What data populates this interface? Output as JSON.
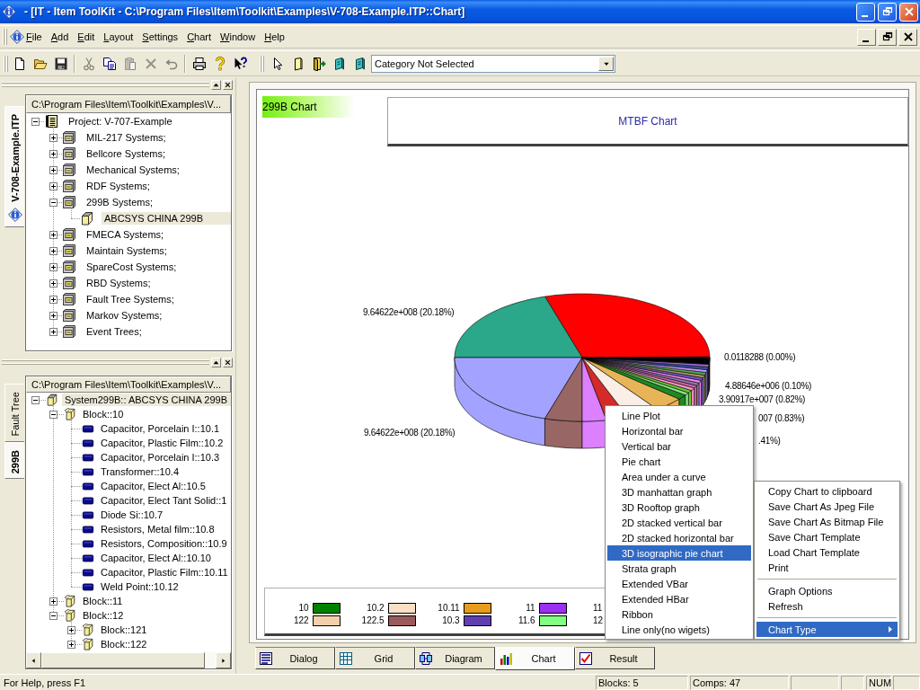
{
  "window": {
    "title": "- [IT - Item ToolKit - C:\\Program Files\\Item\\Toolkit\\Examples\\V-708-Example.ITP::Chart]"
  },
  "menu_bar": [
    "File",
    "Add",
    "Edit",
    "Layout",
    "Settings",
    "Chart",
    "Window",
    "Help"
  ],
  "toolbar": {
    "groups": [
      [
        {
          "kind": "new",
          "disabled": false
        },
        {
          "kind": "open",
          "disabled": false
        },
        {
          "kind": "save",
          "disabled": false
        }
      ],
      [
        {
          "kind": "cut",
          "disabled": true
        },
        {
          "kind": "copy",
          "disabled": false
        },
        {
          "kind": "paste",
          "disabled": true
        },
        {
          "kind": "delete",
          "disabled": true
        },
        {
          "kind": "undo",
          "disabled": true
        }
      ],
      [
        {
          "kind": "print",
          "disabled": false
        },
        {
          "kind": "help",
          "disabled": false
        },
        {
          "kind": "context_help",
          "disabled": false
        }
      ]
    ],
    "tools": [
      {
        "kind": "pointer",
        "disabled": false
      },
      {
        "kind": "document",
        "disabled": false
      },
      {
        "kind": "exit",
        "disabled": false
      },
      {
        "kind": "booklet",
        "disabled": false
      },
      {
        "kind": "booklet",
        "disabled": false
      }
    ],
    "category": "Category Not Selected"
  },
  "project_panel": {
    "tab": {
      "label": "V-708-Example.ITP",
      "selected": true
    },
    "path": "C:\\Program Files\\Item\\Toolkit\\Examples\\V...",
    "tree": [
      {
        "label": "Project: V-707-Example",
        "kind": "project",
        "expanded": true,
        "selected": false,
        "children": [
          {
            "label": "MIL-217 Systems;",
            "kind": "system",
            "expanded": false,
            "selected": false
          },
          {
            "label": "Bellcore Systems;",
            "kind": "system",
            "expanded": false,
            "selected": false
          },
          {
            "label": "Mechanical Systems;",
            "kind": "system",
            "expanded": false,
            "selected": false
          },
          {
            "label": "RDF Systems;",
            "kind": "system",
            "expanded": false,
            "selected": false
          },
          {
            "label": "299B Systems;",
            "kind": "system",
            "expanded": true,
            "selected": false,
            "children": [
              {
                "label": "ABCSYS CHINA 299B",
                "kind": "assembly",
                "selected": true
              }
            ]
          },
          {
            "label": "FMECA Systems;",
            "kind": "system",
            "expanded": false,
            "selected": false
          },
          {
            "label": "Maintain Systems;",
            "kind": "system",
            "expanded": false,
            "selected": false
          },
          {
            "label": "SpareCost Systems;",
            "kind": "system",
            "expanded": false,
            "selected": false
          },
          {
            "label": "RBD Systems;",
            "kind": "system",
            "expanded": false,
            "selected": false
          },
          {
            "label": "Fault Tree Systems;",
            "kind": "system",
            "expanded": false,
            "selected": false
          },
          {
            "label": "Markov Systems;",
            "kind": "system",
            "expanded": false,
            "selected": false
          },
          {
            "label": "Event Trees;",
            "kind": "system",
            "expanded": false,
            "selected": false
          }
        ]
      }
    ]
  },
  "system_panel": {
    "tabs": [
      {
        "label": "Fault Tree",
        "selected": false
      },
      {
        "label": "299B",
        "selected": true
      }
    ],
    "path": "C:\\Program Files\\Item\\Toolkit\\Examples\\V...",
    "tree": [
      {
        "label": "System299B:: ABCSYS CHINA 299B",
        "kind": "assembly",
        "expanded": true,
        "selected": true,
        "children": [
          {
            "label": "Block::10",
            "kind": "block",
            "expanded": true,
            "selected": false,
            "children": [
              {
                "label": "Capacitor, Porcelain I::10.1",
                "kind": "part",
                "selected": false
              },
              {
                "label": "Capacitor, Plastic Film::10.2",
                "kind": "part",
                "selected": false
              },
              {
                "label": "Capacitor, Porcelain I::10.3",
                "kind": "part",
                "selected": false
              },
              {
                "label": "Transformer::10.4",
                "kind": "part",
                "selected": false
              },
              {
                "label": "Capacitor, Elect Al::10.5",
                "kind": "part",
                "selected": false
              },
              {
                "label": "Capacitor, Elect Tant Solid::1",
                "kind": "part",
                "selected": false
              },
              {
                "label": "Diode Si::10.7",
                "kind": "part",
                "selected": false
              },
              {
                "label": "Resistors, Metal film::10.8",
                "kind": "part",
                "selected": false
              },
              {
                "label": "Resistors, Composition::10.9",
                "kind": "part",
                "selected": false
              },
              {
                "label": "Capacitor, Elect Al::10.10",
                "kind": "part",
                "selected": false
              },
              {
                "label": "Capacitor, Plastic Film::10.11",
                "kind": "part",
                "selected": false
              },
              {
                "label": "Weld Point::10.12",
                "kind": "part",
                "selected": false
              }
            ]
          },
          {
            "label": "Block::11",
            "kind": "block",
            "expanded": false,
            "selected": false
          },
          {
            "label": "Block::12",
            "kind": "block",
            "expanded": true,
            "selected": false,
            "children": [
              {
                "label": "Block::121",
                "kind": "block",
                "expanded": false,
                "selected": false
              },
              {
                "label": "Block::122",
                "kind": "block",
                "expanded": false,
                "selected": false
              }
            ]
          }
        ]
      }
    ]
  },
  "chart_view": {
    "name_label": "299B Chart",
    "title": "MTBF Chart",
    "data_labels": [
      "9.64622e+008 (20.18%)",
      "9.64622e+008 (20.18%)",
      "0.0118288 (0.00%)",
      "4.88646e+006 (0.10%)",
      "3.90917e+007 (0.82%)",
      "007 (0.83%)",
      ".41%)"
    ],
    "legend": [
      {
        "label": "10",
        "color": "#008000"
      },
      {
        "label": "10.2",
        "color": "#f9dfc6"
      },
      {
        "label": "10.11",
        "color": "#e89c1c"
      },
      {
        "label": "11",
        "color": "#9a30f0"
      },
      {
        "label": "11"
      },
      {
        "label": "122",
        "color": "#f5cfaa"
      },
      {
        "label": "122.5",
        "color": "#9a5a5a"
      },
      {
        "label": "10.3",
        "color": "#6040b0"
      },
      {
        "label": "11.6",
        "color": "#80ff80"
      },
      {
        "label": "12"
      }
    ]
  },
  "chart_type_menu": [
    {
      "label": "Line Plot",
      "selected": false
    },
    {
      "label": "Horizontal bar",
      "selected": false
    },
    {
      "label": "Vertical bar",
      "selected": false
    },
    {
      "label": "Pie chart",
      "selected": false
    },
    {
      "label": "Area under a curve",
      "selected": false
    },
    {
      "label": "3D manhattan graph",
      "selected": false
    },
    {
      "label": "3D Rooftop graph",
      "selected": false
    },
    {
      "label": "2D stacked vertical bar",
      "selected": false
    },
    {
      "label": "2D stacked horizontal bar",
      "selected": false
    },
    {
      "label": "3D isographic pie chart",
      "selected": true
    },
    {
      "label": "Strata graph",
      "selected": false
    },
    {
      "label": "Extended VBar",
      "selected": false
    },
    {
      "label": "Extended HBar",
      "selected": false
    },
    {
      "label": "Ribbon",
      "selected": false
    },
    {
      "label": "Line only(no wigets)",
      "selected": false
    }
  ],
  "context_menu": [
    [
      {
        "label": "Copy Chart to clipboard",
        "selected": false,
        "submenu": false
      },
      {
        "label": "Save Chart As Jpeg File",
        "selected": false,
        "submenu": false
      },
      {
        "label": "Save Chart As Bitmap File",
        "selected": false,
        "submenu": false
      },
      {
        "label": "Save Chart Template",
        "selected": false,
        "submenu": false
      },
      {
        "label": "Load Chart Template",
        "selected": false,
        "submenu": false
      },
      {
        "label": "Print",
        "selected": false,
        "submenu": false
      }
    ],
    [
      {
        "label": "Graph Options",
        "selected": false,
        "submenu": false
      },
      {
        "label": "Refresh",
        "selected": false,
        "submenu": false
      }
    ],
    [
      {
        "label": "Chart Type",
        "selected": true,
        "submenu": true
      }
    ]
  ],
  "view_tabs": [
    {
      "label": "Dialog",
      "kind": "dialog",
      "selected": false
    },
    {
      "label": "Grid",
      "kind": "grid",
      "selected": false
    },
    {
      "label": "Diagram",
      "kind": "diagram",
      "selected": false
    },
    {
      "label": "Chart",
      "kind": "chart",
      "selected": true
    },
    {
      "label": "Result",
      "kind": "result",
      "selected": false
    }
  ],
  "status_bar": {
    "message": "For Help, press F1",
    "blocks": "Blocks: 5",
    "comps": "Comps: 47",
    "num": "NUM"
  }
}
